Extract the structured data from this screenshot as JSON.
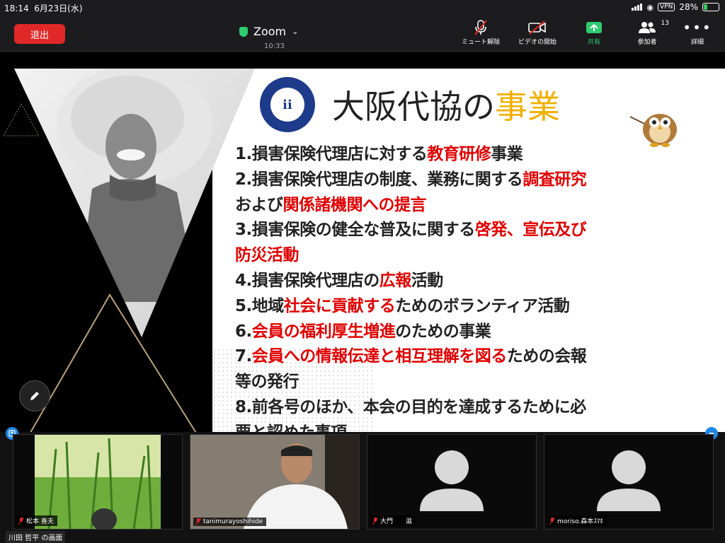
{
  "status_bar": {
    "time": "18:14",
    "date": "6月23日(水)",
    "vpn": "VPN",
    "battery": "28%",
    "battery_level": 0.28
  },
  "toolbar": {
    "leave_label": "退出",
    "app_title": "Zoom",
    "duration": "10:33",
    "buttons": [
      {
        "label": "ミュート解除",
        "icon": "mic-off-icon"
      },
      {
        "label": "ビデオの開始",
        "icon": "video-off-icon"
      },
      {
        "label": "共有",
        "icon": "share-icon"
      },
      {
        "label": "参加者",
        "icon": "participants-icon",
        "count": "13"
      },
      {
        "label": "詳細",
        "icon": "more-icon"
      }
    ]
  },
  "slide": {
    "logo_text": "ii",
    "title_main": "大阪代協の",
    "title_highlight": "事業",
    "lines": [
      [
        {
          "t": "1.損害保険代理店に対する"
        },
        {
          "t": "教育研修",
          "r": true
        },
        {
          "t": "事業"
        }
      ],
      [
        {
          "t": "2.損害保険代理店の制度、業務に関する"
        },
        {
          "t": "調査研究",
          "r": true
        }
      ],
      [
        {
          "t": "および"
        },
        {
          "t": "関係諸機関への提言",
          "r": true
        }
      ],
      [
        {
          "t": "3.損害保険の健全な普及に関する"
        },
        {
          "t": "啓発、宣伝及び",
          "r": true
        }
      ],
      [
        {
          "t": "防災活動",
          "r": true
        }
      ],
      [
        {
          "t": "4.損害保険代理店の"
        },
        {
          "t": "広報",
          "r": true
        },
        {
          "t": "活動"
        }
      ],
      [
        {
          "t": "5.地域"
        },
        {
          "t": "社会に貢献する",
          "r": true
        },
        {
          "t": "ためのボランティア活動"
        }
      ],
      [
        {
          "t": "6."
        },
        {
          "t": "会員の福利厚生増進",
          "r": true
        },
        {
          "t": "のための事業"
        }
      ],
      [
        {
          "t": "7."
        },
        {
          "t": "会員への情報伝達と相互理解を図る",
          "r": true
        },
        {
          "t": "ための会報"
        }
      ],
      [
        {
          "t": "等の発行"
        }
      ],
      [
        {
          "t": "8.前各号のほか、本会の目的を達成するために必"
        }
      ],
      [
        {
          "t": "要と認めた事項"
        }
      ]
    ]
  },
  "participants": [
    {
      "name": "松本 喜夫",
      "kind": "video-grass"
    },
    {
      "name": "tanimurayoshihide",
      "kind": "video-person"
    },
    {
      "name": "大門　　滋",
      "kind": "avatar"
    },
    {
      "name": "moriso.森本ｽﾏﾎ",
      "kind": "avatar"
    }
  ],
  "share_label": "川田 哲平 の画面"
}
